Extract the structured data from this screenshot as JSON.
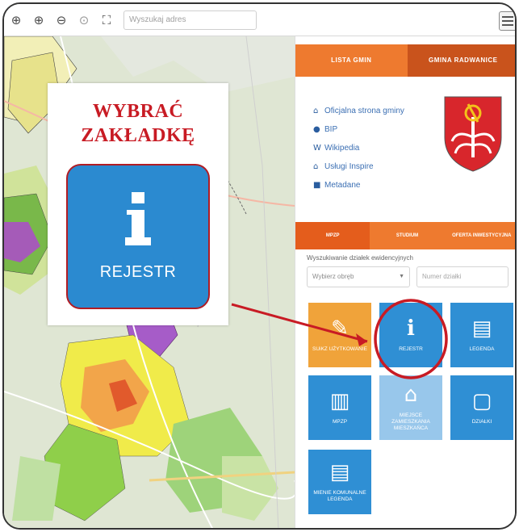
{
  "toolbar": {
    "search_placeholder": "Wyszukaj adres",
    "tools": [
      "crosshair-icon",
      "zoom-in-icon",
      "zoom-out-icon",
      "zoom-reset-icon",
      "fullscreen-icon"
    ]
  },
  "panel": {
    "top_tabs": [
      "LISTA GMIN",
      "GMINA RADWANICE"
    ],
    "links": [
      {
        "icon": "home-icon",
        "label": "Oficjalna strona gminy"
      },
      {
        "icon": "info-icon",
        "label": "BIP"
      },
      {
        "icon": "wikipedia-icon",
        "label": "Wikipedia"
      },
      {
        "icon": "bank-icon",
        "label": "Usługi Inspire"
      },
      {
        "icon": "book-icon",
        "label": "Metadane"
      }
    ],
    "mid_tabs": [
      "MPZP",
      "STUDIUM",
      "OFERTA INWESTYCYJNA"
    ],
    "search_label": "Wyszukiwanie działek ewidencyjnych",
    "select_placeholder": "Wybierz obręb",
    "parcel_placeholder": "Numer działki",
    "tiles": [
      {
        "label": "SUiKZ UŻYTKOWANIE",
        "icon": "compass-icon"
      },
      {
        "label": "REJESTR",
        "icon": "info-icon"
      },
      {
        "label": "LEGENDA",
        "icon": "map-legend-icon"
      },
      {
        "label": "MPZP",
        "icon": "map-icon"
      },
      {
        "label": "MIEJSCE ZAMIESZKANIA MIESZKAŃCA",
        "icon": "house-icon"
      },
      {
        "label": "DZIAŁKI",
        "icon": "square-icon"
      },
      {
        "label": "MIENIE KOMUNALNE LEGENDA",
        "icon": "map-legend-icon"
      }
    ]
  },
  "callout": {
    "title_line1": "WYBRAĆ",
    "title_line2": "ZAKŁADKĘ",
    "button_label": "REJESTR"
  },
  "colors": {
    "orange": "#ee7a2f",
    "blue": "#2f8fd4",
    "red": "#c81b24"
  }
}
